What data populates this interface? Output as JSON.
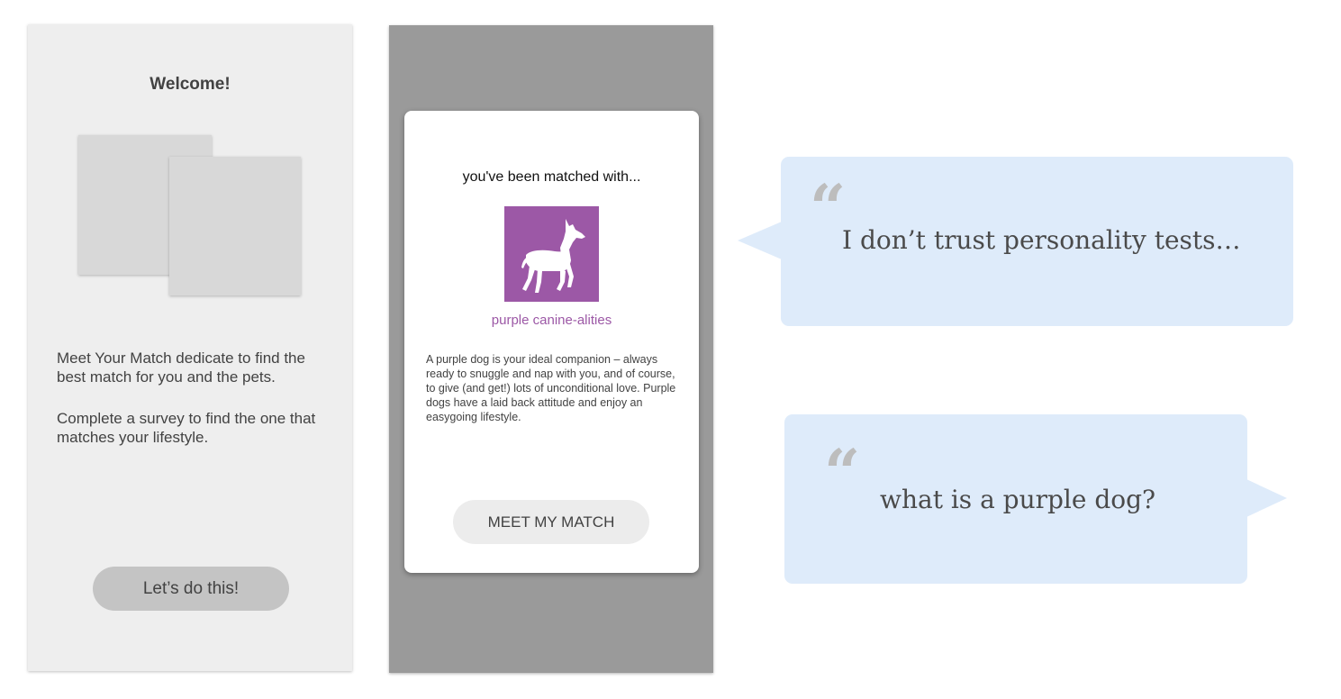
{
  "welcome_screen": {
    "title": "Welcome!",
    "paragraph_1": "Meet Your Match dedicate to find the best match for you and the pets.",
    "paragraph_2": "Complete a survey to find the one that matches your lifestyle.",
    "cta_label": "Let’s do this!"
  },
  "match_screen": {
    "heading": "you've been matched with...",
    "dog_icon": "dog-silhouette-icon",
    "match_name": "purple canine-alities",
    "description": "A purple dog is your ideal companion – always ready to snuggle and nap with you, and of course, to give (and get!) lots of unconditional love. Purple dogs have a laid back attitude and enjoy an easygoing lifestyle.",
    "cta_label": "MEET MY MATCH"
  },
  "quotes": [
    {
      "mark": "“",
      "text": "I don’t trust personality tests…"
    },
    {
      "mark": "“",
      "text": "what is a purple dog?"
    }
  ],
  "colors": {
    "accent_purple": "#9c58a6",
    "bubble_blue": "#deebfa",
    "overlay_gray": "#9a9a9a",
    "screen_bg": "#eeeeee"
  }
}
